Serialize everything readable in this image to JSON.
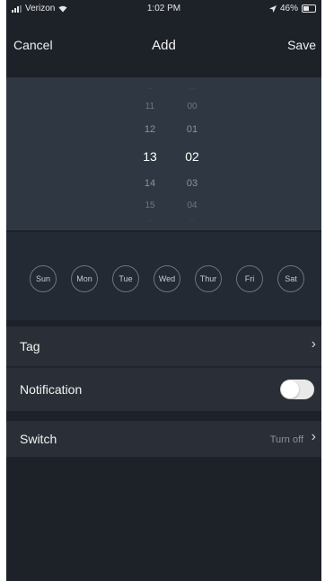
{
  "status_bar": {
    "carrier": "Verizon",
    "time": "1:02 PM",
    "battery": "46%"
  },
  "nav": {
    "cancel": "Cancel",
    "title": "Add",
    "save": "Save"
  },
  "picker": {
    "hours": [
      "11",
      "12",
      "13",
      "14",
      "15"
    ],
    "minutes": [
      "00",
      "01",
      "02",
      "03",
      "04"
    ],
    "selected_hour": "13",
    "selected_minute": "02"
  },
  "weekdays": [
    "Sun",
    "Mon",
    "Tue",
    "Wed",
    "Thur",
    "Fri",
    "Sat"
  ],
  "rows": {
    "tag": {
      "label": "Tag"
    },
    "notification": {
      "label": "Notification",
      "enabled": false
    },
    "switch": {
      "label": "Switch",
      "value": "Turn off"
    }
  },
  "colors": {
    "background": "#1d2128",
    "picker": "#2f3742",
    "row": "#2a2f37",
    "text": "#f2f2f2"
  }
}
